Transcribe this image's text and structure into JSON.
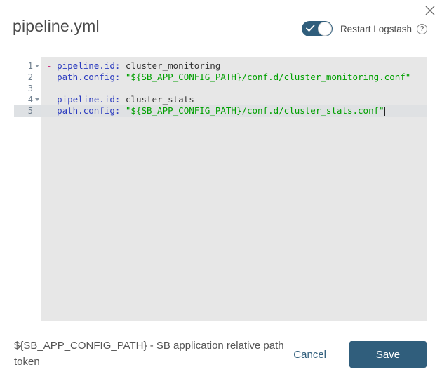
{
  "modal": {
    "title": "pipeline.yml"
  },
  "header": {
    "toggle": {
      "label": "Restart Logstash",
      "state_on": true
    },
    "help_glyph": "?"
  },
  "editor": {
    "lines": [
      {
        "num": "1",
        "fold": true,
        "active": false,
        "cursor": false,
        "tokens": [
          [
            "meta",
            "- "
          ],
          [
            "key",
            "pipeline.id:"
          ],
          [
            "plain",
            " cluster_monitoring"
          ]
        ]
      },
      {
        "num": "2",
        "fold": false,
        "active": false,
        "cursor": false,
        "tokens": [
          [
            "plain",
            "  "
          ],
          [
            "key",
            "path.config:"
          ],
          [
            "plain",
            " "
          ],
          [
            "string",
            "\"${SB_APP_CONFIG_PATH}/conf.d/cluster_monitoring.conf\""
          ]
        ]
      },
      {
        "num": "3",
        "fold": false,
        "active": false,
        "cursor": false,
        "tokens": []
      },
      {
        "num": "4",
        "fold": true,
        "active": false,
        "cursor": false,
        "tokens": [
          [
            "meta",
            "- "
          ],
          [
            "key",
            "pipeline.id:"
          ],
          [
            "plain",
            " cluster_stats"
          ]
        ]
      },
      {
        "num": "5",
        "fold": false,
        "active": true,
        "cursor": true,
        "tokens": [
          [
            "plain",
            "  "
          ],
          [
            "key",
            "path.config:"
          ],
          [
            "plain",
            " "
          ],
          [
            "string",
            "\"${SB_APP_CONFIG_PATH}/conf.d/cluster_stats.conf\""
          ]
        ]
      }
    ]
  },
  "footer": {
    "hint": "${SB_APP_CONFIG_PATH} - SB application relative path token",
    "cancel_label": "Cancel",
    "save_label": "Save"
  },
  "colors": {
    "accent": "#305e7c",
    "key": "#2b3bbf",
    "list_dash": "#cc3380",
    "string": "#00a000",
    "editor_bg": "#e7e7e7",
    "active_line_bg": "#dfe1e3"
  }
}
